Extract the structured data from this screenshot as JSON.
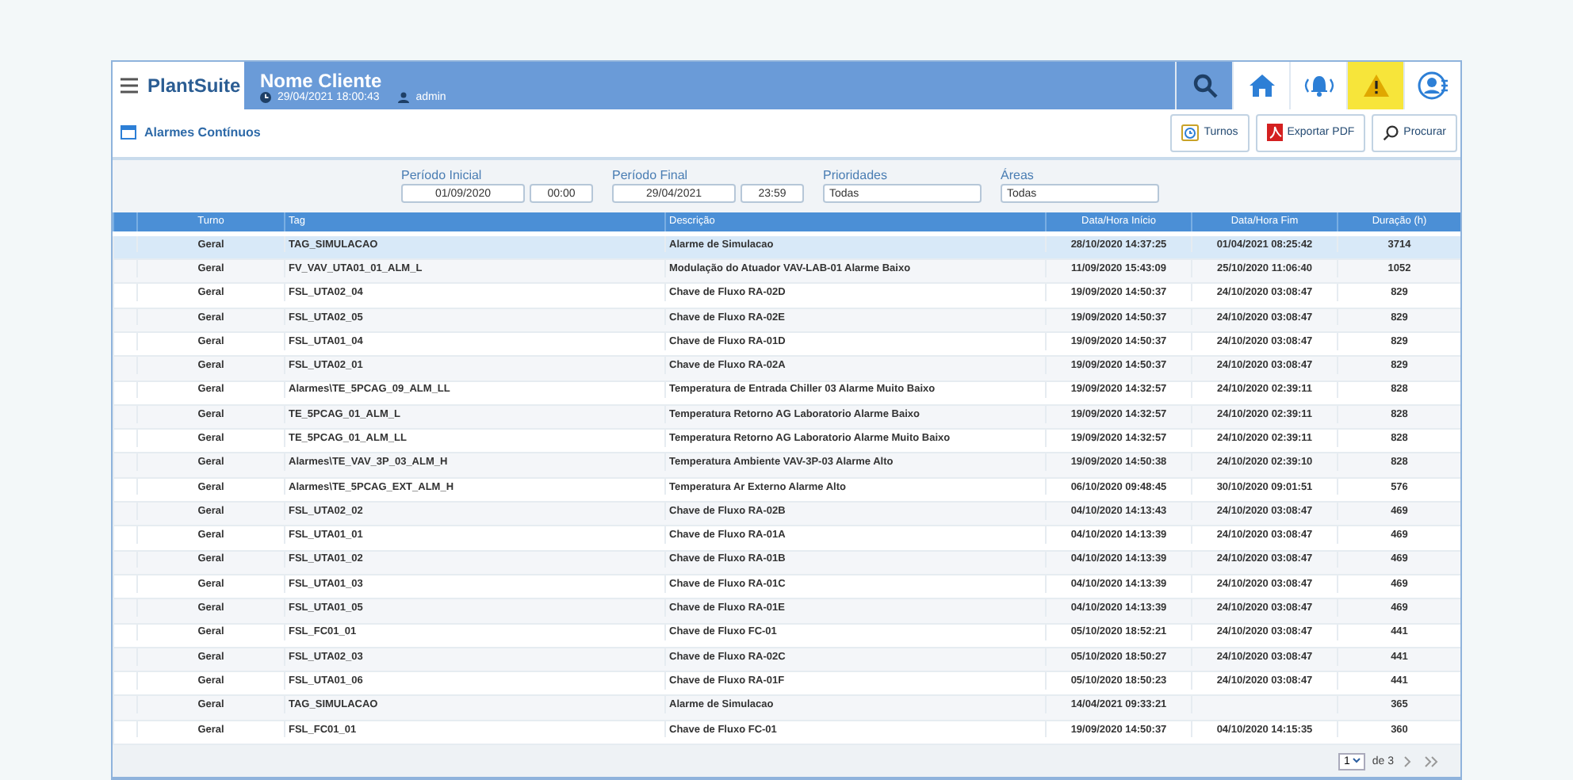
{
  "header": {
    "brand": "PlantSuite",
    "client": "Nome Cliente",
    "datetime": "29/04/2021 18:00:43",
    "user": "admin",
    "nav_icons": [
      {
        "kind": "search",
        "selected": false
      },
      {
        "kind": "home",
        "selected": false
      },
      {
        "kind": "alarm",
        "selected": false
      },
      {
        "kind": "warning",
        "selected": true
      },
      {
        "kind": "user",
        "selected": false
      }
    ]
  },
  "page_title": "Alarmes Contínuos",
  "toolbar_buttons": [
    {
      "kind": "shifts",
      "label": "Turnos"
    },
    {
      "kind": "pdf",
      "label": "Exportar PDF"
    },
    {
      "kind": "search",
      "label": "Procurar"
    }
  ],
  "filters": [
    {
      "label": "Período Inicial",
      "values": [
        "01/09/2020",
        "00:00"
      ]
    },
    {
      "label": "Período Final",
      "values": [
        "29/04/2021",
        "23:59"
      ]
    },
    {
      "label": "Prioridades",
      "values": [
        "Todas"
      ]
    },
    {
      "label": "Áreas",
      "values": [
        "Todas"
      ]
    }
  ],
  "table": {
    "columns": [
      "Turno",
      "Tag",
      "Descrição",
      "Data/Hora Início",
      "Data/Hora Fim",
      "Duração (h)"
    ],
    "rows": [
      {
        "selected": true,
        "cells": [
          "Geral",
          "TAG_SIMULACAO",
          "Alarme de Simulacao",
          "28/10/2020 14:37:25",
          "01/04/2021 08:25:42",
          "3714"
        ]
      },
      {
        "selected": false,
        "cells": [
          "Geral",
          "FV_VAV_UTA01_01_ALM_L",
          "Modulação do Atuador VAV-LAB-01 Alarme Baixo",
          "11/09/2020 15:43:09",
          "25/10/2020 11:06:40",
          "1052"
        ]
      },
      {
        "selected": false,
        "cells": [
          "Geral",
          "FSL_UTA02_04",
          "Chave de Fluxo RA-02D",
          "19/09/2020 14:50:37",
          "24/10/2020 03:08:47",
          "829"
        ]
      },
      {
        "selected": false,
        "cells": [
          "Geral",
          "FSL_UTA02_05",
          "Chave de Fluxo RA-02E",
          "19/09/2020 14:50:37",
          "24/10/2020 03:08:47",
          "829"
        ]
      },
      {
        "selected": false,
        "cells": [
          "Geral",
          "FSL_UTA01_04",
          "Chave de Fluxo RA-01D",
          "19/09/2020 14:50:37",
          "24/10/2020 03:08:47",
          "829"
        ]
      },
      {
        "selected": false,
        "cells": [
          "Geral",
          "FSL_UTA02_01",
          "Chave de Fluxo RA-02A",
          "19/09/2020 14:50:37",
          "24/10/2020 03:08:47",
          "829"
        ]
      },
      {
        "selected": false,
        "cells": [
          "Geral",
          "Alarmes\\TE_5PCAG_09_ALM_LL",
          "Temperatura de Entrada Chiller 03 Alarme Muito Baixo",
          "19/09/2020 14:32:57",
          "24/10/2020 02:39:11",
          "828"
        ]
      },
      {
        "selected": false,
        "cells": [
          "Geral",
          "TE_5PCAG_01_ALM_L",
          "Temperatura Retorno AG Laboratorio Alarme Baixo",
          "19/09/2020 14:32:57",
          "24/10/2020 02:39:11",
          "828"
        ]
      },
      {
        "selected": false,
        "cells": [
          "Geral",
          "TE_5PCAG_01_ALM_LL",
          "Temperatura Retorno AG Laboratorio Alarme Muito Baixo",
          "19/09/2020 14:32:57",
          "24/10/2020 02:39:11",
          "828"
        ]
      },
      {
        "selected": false,
        "cells": [
          "Geral",
          "Alarmes\\TE_VAV_3P_03_ALM_H",
          "Temperatura Ambiente VAV-3P-03 Alarme Alto",
          "19/09/2020 14:50:38",
          "24/10/2020 02:39:10",
          "828"
        ]
      },
      {
        "selected": false,
        "cells": [
          "Geral",
          "Alarmes\\TE_5PCAG_EXT_ALM_H",
          "Temperatura Ar Externo Alarme Alto",
          "06/10/2020 09:48:45",
          "30/10/2020 09:01:51",
          "576"
        ]
      },
      {
        "selected": false,
        "cells": [
          "Geral",
          "FSL_UTA02_02",
          "Chave de Fluxo RA-02B",
          "04/10/2020 14:13:43",
          "24/10/2020 03:08:47",
          "469"
        ]
      },
      {
        "selected": false,
        "cells": [
          "Geral",
          "FSL_UTA01_01",
          "Chave de Fluxo RA-01A",
          "04/10/2020 14:13:39",
          "24/10/2020 03:08:47",
          "469"
        ]
      },
      {
        "selected": false,
        "cells": [
          "Geral",
          "FSL_UTA01_02",
          "Chave de Fluxo RA-01B",
          "04/10/2020 14:13:39",
          "24/10/2020 03:08:47",
          "469"
        ]
      },
      {
        "selected": false,
        "cells": [
          "Geral",
          "FSL_UTA01_03",
          "Chave de Fluxo RA-01C",
          "04/10/2020 14:13:39",
          "24/10/2020 03:08:47",
          "469"
        ]
      },
      {
        "selected": false,
        "cells": [
          "Geral",
          "FSL_UTA01_05",
          "Chave de Fluxo RA-01E",
          "04/10/2020 14:13:39",
          "24/10/2020 03:08:47",
          "469"
        ]
      },
      {
        "selected": false,
        "cells": [
          "Geral",
          "FSL_FC01_01",
          "Chave de Fluxo FC-01",
          "05/10/2020 18:52:21",
          "24/10/2020 03:08:47",
          "441"
        ]
      },
      {
        "selected": false,
        "cells": [
          "Geral",
          "FSL_UTA02_03",
          "Chave de Fluxo RA-02C",
          "05/10/2020 18:50:27",
          "24/10/2020 03:08:47",
          "441"
        ]
      },
      {
        "selected": false,
        "cells": [
          "Geral",
          "FSL_UTA01_06",
          "Chave de Fluxo RA-01F",
          "05/10/2020 18:50:23",
          "24/10/2020 03:08:47",
          "441"
        ]
      },
      {
        "selected": false,
        "cells": [
          "Geral",
          "TAG_SIMULACAO",
          "Alarme de Simulacao",
          "14/04/2021 09:33:21",
          null,
          "365"
        ]
      },
      {
        "selected": false,
        "cells": [
          "Geral",
          "FSL_FC01_01",
          "Chave de Fluxo FC-01",
          "19/09/2020 14:50:37",
          "04/10/2020 14:15:35",
          "360"
        ]
      }
    ]
  },
  "pagination": {
    "page": "1",
    "total": "de 3"
  }
}
